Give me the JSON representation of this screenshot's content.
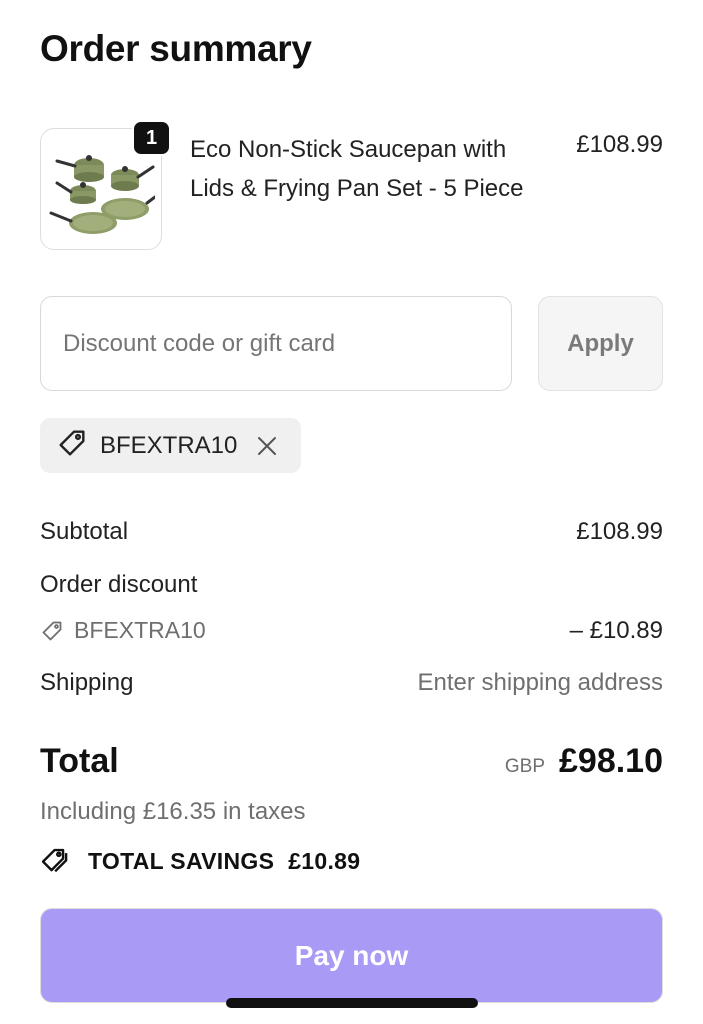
{
  "page": {
    "title": "Order summary"
  },
  "cart": {
    "items": [
      {
        "quantity": "1",
        "name": "Eco Non-Stick Saucepan with Lids & Frying Pan Set - 5 Piece",
        "price": "£108.99",
        "image_icon": "cookware-set-image"
      }
    ]
  },
  "discount": {
    "placeholder": "Discount code or gift card",
    "value": "",
    "apply_label": "Apply",
    "applied_code": "BFEXTRA10",
    "chip_icon": "tag-icon",
    "remove_icon": "close-icon"
  },
  "summary": {
    "subtotal_label": "Subtotal",
    "subtotal_value": "£108.99",
    "order_discount_label": "Order discount",
    "discount_code": "BFEXTRA10",
    "discount_value": "– £10.89",
    "shipping_label": "Shipping",
    "shipping_value": "Enter shipping address",
    "total_label": "Total",
    "total_currency": "GBP",
    "total_value": "£98.10",
    "taxes_note": "Including £16.35 in taxes",
    "savings_label": "TOTAL SAVINGS",
    "savings_value": "£10.89"
  },
  "actions": {
    "pay_label": "Pay now"
  },
  "colors": {
    "pay_button": "#a99af5",
    "chip_background": "#f0f0f0",
    "muted_text": "#6f6f6f"
  }
}
